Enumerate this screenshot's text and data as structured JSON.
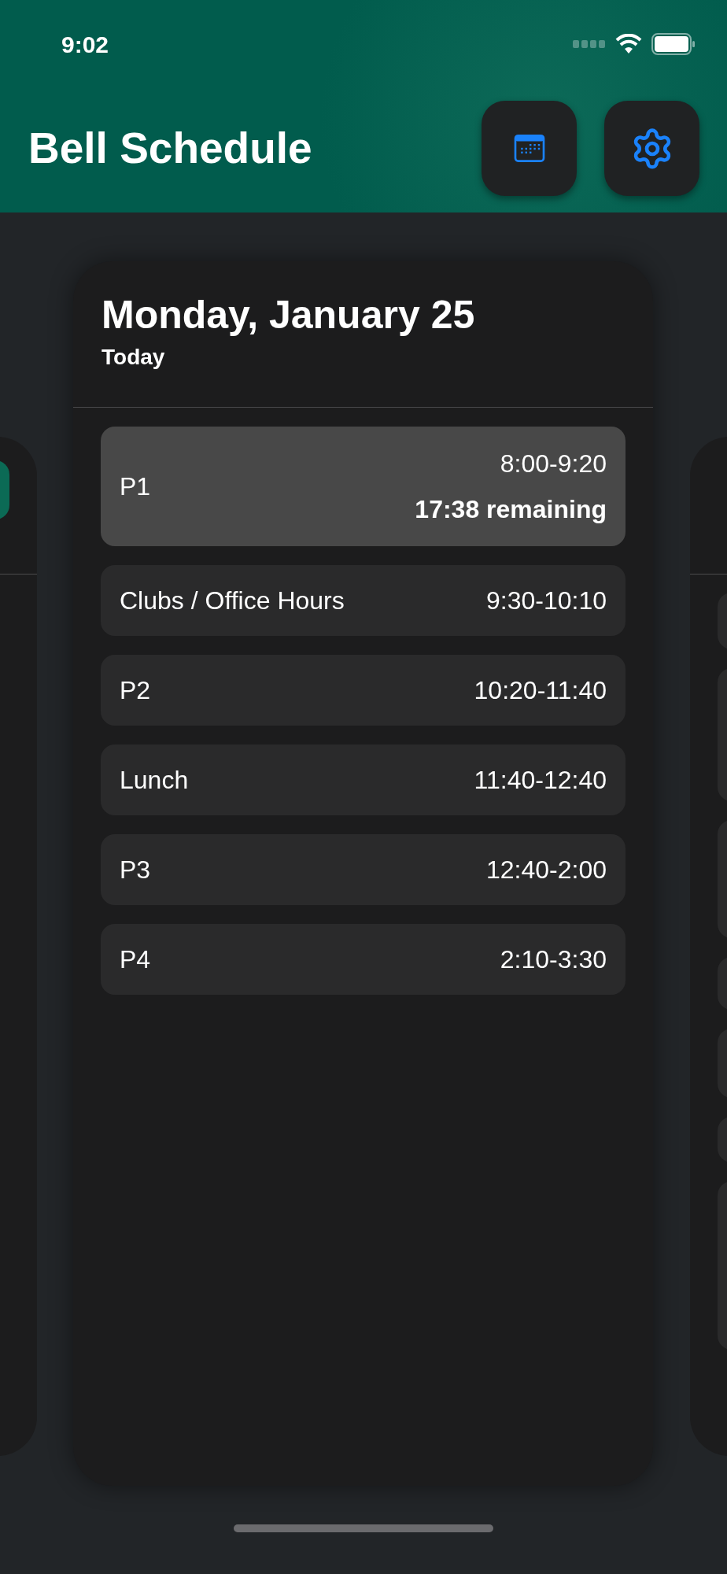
{
  "status_bar": {
    "time": "9:02"
  },
  "header": {
    "title": "Bell Schedule"
  },
  "day_card": {
    "title": "Monday, January 25",
    "subtitle": "Today",
    "periods": [
      {
        "name": "P1",
        "time": "8:00-9:20",
        "remaining": "17:38 remaining",
        "selected": true
      },
      {
        "name": "Clubs / Office Hours",
        "time": "9:30-10:10",
        "selected": false
      },
      {
        "name": "P2",
        "time": "10:20-11:40",
        "selected": false
      },
      {
        "name": "Lunch",
        "time": "11:40-12:40",
        "selected": false
      },
      {
        "name": "P3",
        "time": "12:40-2:00",
        "selected": false
      },
      {
        "name": "P4",
        "time": "2:10-3:30",
        "selected": false
      }
    ]
  }
}
